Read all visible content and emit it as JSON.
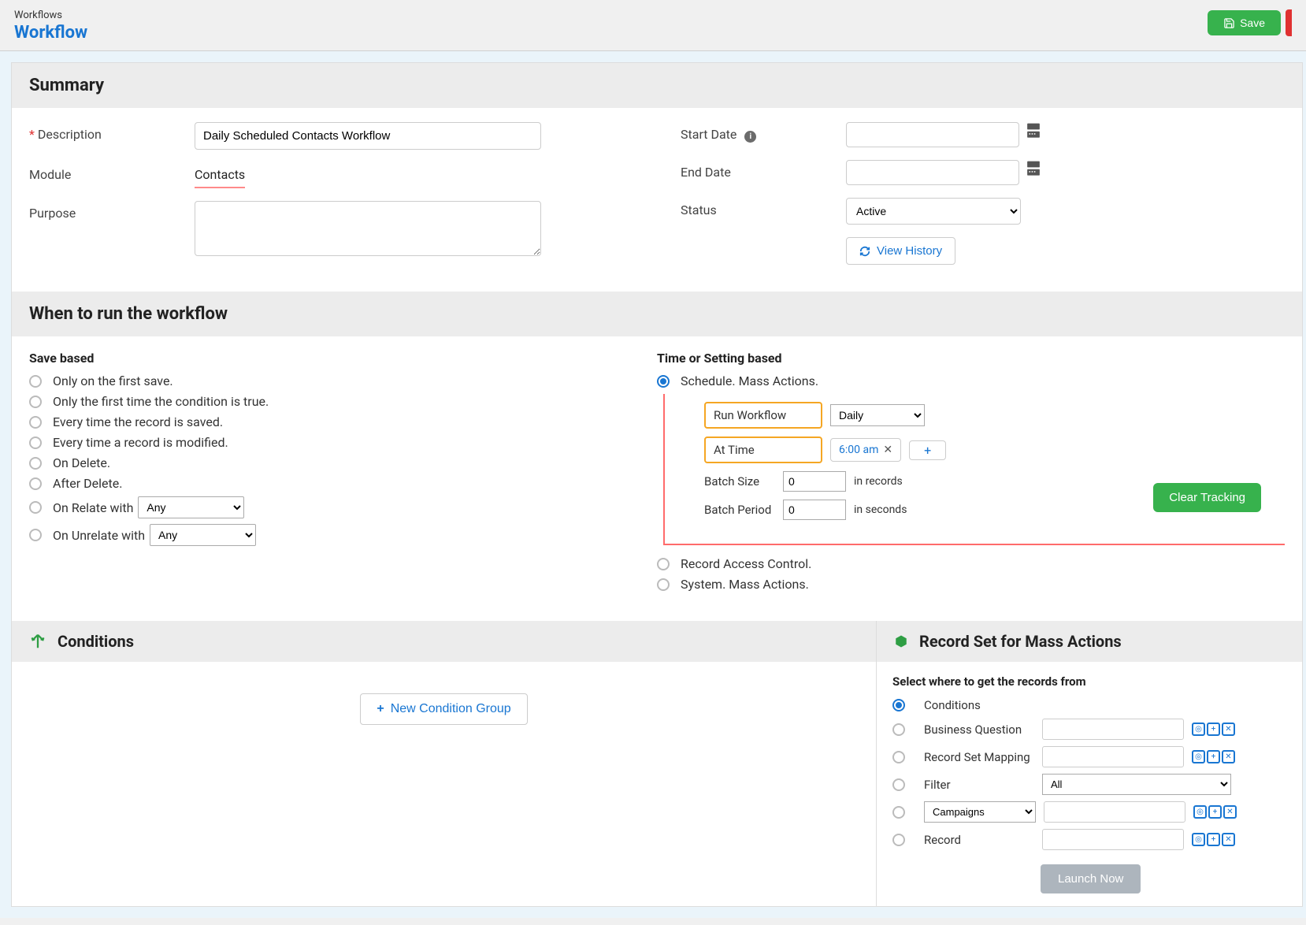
{
  "breadcrumb": "Workflows",
  "page_title": "Workflow",
  "actions": {
    "save": "Save"
  },
  "summary": {
    "heading": "Summary",
    "description_label": "Description",
    "description_value": "Daily Scheduled Contacts Workflow",
    "module_label": "Module",
    "module_value": "Contacts",
    "purpose_label": "Purpose",
    "purpose_value": "",
    "start_date_label": "Start Date",
    "start_date_value": "",
    "end_date_label": "End Date",
    "end_date_value": "",
    "status_label": "Status",
    "status_value": "Active",
    "view_history_label": "View History"
  },
  "run": {
    "heading": "When to run the workflow",
    "save_based_heading": "Save based",
    "opts": {
      "first_save": "Only on the first save.",
      "first_cond": "Only the first time the condition is true.",
      "every_save": "Every time the record is saved.",
      "every_modify": "Every time a record is modified.",
      "on_delete": "On Delete.",
      "after_delete": "After Delete.",
      "on_relate": "On Relate with",
      "on_unrelate": "On Unrelate with",
      "relate_any": "Any"
    },
    "time_heading": "Time or Setting based",
    "time_opts": {
      "schedule": "Schedule. Mass Actions.",
      "rac": "Record Access Control.",
      "system": "System. Mass Actions."
    },
    "schedule": {
      "run_workflow_label": "Run Workflow",
      "frequency": "Daily",
      "at_time_label": "At Time",
      "time_chip": "6:00 am",
      "batch_size_label": "Batch Size",
      "batch_size_value": "0",
      "batch_size_unit": "in records",
      "batch_period_label": "Batch Period",
      "batch_period_value": "0",
      "batch_period_unit": "in seconds",
      "clear_tracking": "Clear Tracking"
    }
  },
  "conditions": {
    "heading": "Conditions",
    "new_group": "New Condition Group"
  },
  "recordset": {
    "heading": "Record Set for Mass Actions",
    "subheading": "Select where to get the records from",
    "conditions": "Conditions",
    "business_question": "Business Question",
    "mapping": "Record Set Mapping",
    "filter": "Filter",
    "filter_value": "All",
    "campaigns": "Campaigns",
    "record": "Record",
    "launch": "Launch Now"
  }
}
